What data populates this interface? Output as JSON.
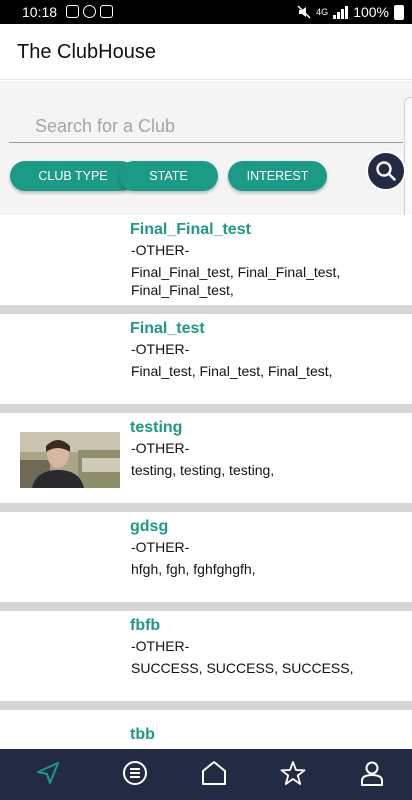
{
  "status_bar": {
    "time": "10:18",
    "network": "4G",
    "battery": "100%"
  },
  "app_bar": {
    "title": "The ClubHouse"
  },
  "search": {
    "placeholder": "Search for a Club"
  },
  "filters": {
    "club_type_label": "CLUB TYPE",
    "state_label": "STATE",
    "interest_label": "INTEREST"
  },
  "clubs": [
    {
      "name": "Final_Final_test",
      "type": "-OTHER-",
      "interests": "Final_Final_test, Final_Final_test, Final_Final_test,"
    },
    {
      "name": "Final_test",
      "type": "-OTHER-",
      "interests": "Final_test, Final_test, Final_test,"
    },
    {
      "name": "testing",
      "type": "-OTHER-",
      "interests": "testing, testing, testing,"
    },
    {
      "name": "gdsg",
      "type": "-OTHER-",
      "interests": "hfgh, fgh, fghfghgfh,"
    },
    {
      "name": "fbfb",
      "type": "-OTHER-",
      "interests": "SUCCESS, SUCCESS, SUCCESS,"
    },
    {
      "name": "tbb",
      "type": "",
      "interests": ""
    }
  ],
  "bottom_nav": {
    "items": [
      "send-icon",
      "list-icon",
      "home-icon",
      "star-icon",
      "profile-icon"
    ],
    "active_color": "#1b9a86",
    "icon_color": "#ffffff"
  },
  "colors": {
    "accent": "#1b9a86",
    "nav_background": "#232a44",
    "separator": "#d6d6d6"
  }
}
